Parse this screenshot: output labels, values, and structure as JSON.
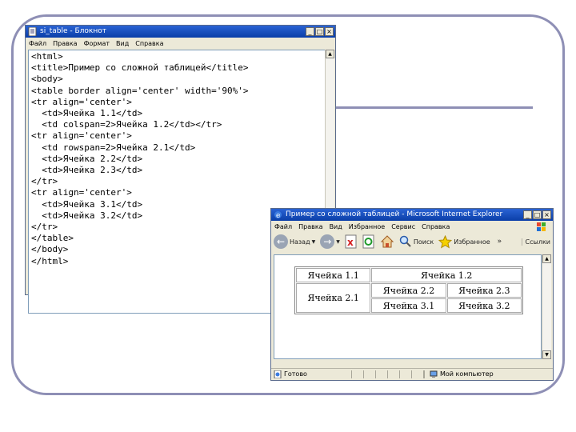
{
  "notepad": {
    "title": "si_table - Блокнот",
    "menu": [
      "Файл",
      "Правка",
      "Формат",
      "Вид",
      "Справка"
    ],
    "lines": [
      "<html>",
      "<title>Пример со сложной таблицей</title>",
      "<body>",
      "<table border align='center' width='90%'>",
      "<tr align='center'>",
      "  <td>Ячейка 1.1</td>",
      "  <td colspan=2>Ячейка 1.2</td></tr>",
      "<tr align='center'>",
      "  <td rowspan=2>Ячейка 2.1</td>",
      "  <td>Ячейка 2.2</td>",
      "  <td>Ячейка 2.3</td>",
      "</tr>",
      "<tr align='center'>",
      "  <td>Ячейка 3.1</td>",
      "  <td>Ячейка 3.2</td>",
      "</tr>",
      "</table>",
      "</body>",
      "</html>"
    ]
  },
  "browser": {
    "title": "Пример со сложной таблицей - Microsoft Internet Explorer",
    "menu": [
      "Файл",
      "Правка",
      "Вид",
      "Избранное",
      "Сервис",
      "Справка"
    ],
    "toolbar": {
      "back": "Назад",
      "search": "Поиск",
      "favorites": "Избранное",
      "links": "Ссылки",
      "more": "»"
    },
    "table": {
      "c11": "Ячейка 1.1",
      "c12": "Ячейка 1.2",
      "c21": "Ячейка 2.1",
      "c22": "Ячейка 2.2",
      "c23": "Ячейка 2.3",
      "c31": "Ячейка 3.1",
      "c32": "Ячейка 3.2"
    },
    "status": {
      "left": "Готово",
      "zone": "Мой компьютер"
    }
  },
  "colors": {
    "frame": "#8e8fb5",
    "titlebar": "#0a3ea8"
  }
}
